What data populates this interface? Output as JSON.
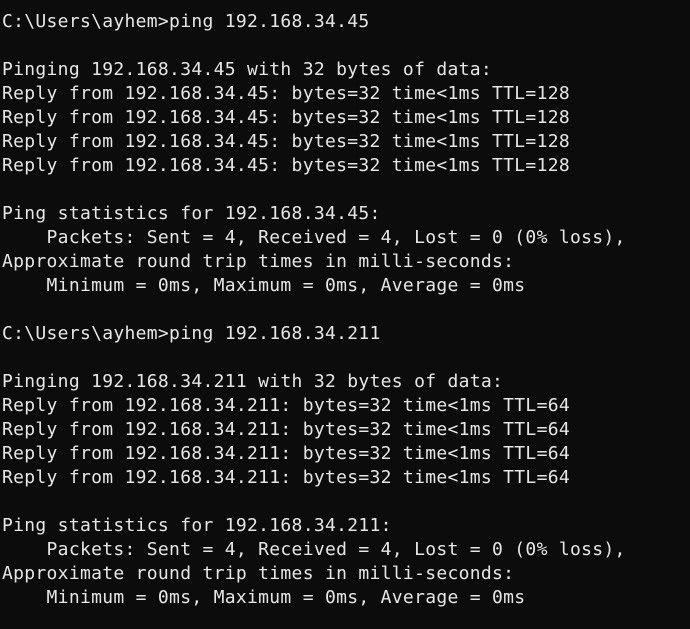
{
  "terminal": {
    "lines": [
      "C:\\Users\\ayhem>ping 192.168.34.45",
      "",
      "Pinging 192.168.34.45 with 32 bytes of data:",
      "Reply from 192.168.34.45: bytes=32 time<1ms TTL=128",
      "Reply from 192.168.34.45: bytes=32 time<1ms TTL=128",
      "Reply from 192.168.34.45: bytes=32 time<1ms TTL=128",
      "Reply from 192.168.34.45: bytes=32 time<1ms TTL=128",
      "",
      "Ping statistics for 192.168.34.45:",
      "    Packets: Sent = 4, Received = 4, Lost = 0 (0% loss),",
      "Approximate round trip times in milli-seconds:",
      "    Minimum = 0ms, Maximum = 0ms, Average = 0ms",
      "",
      "C:\\Users\\ayhem>ping 192.168.34.211",
      "",
      "Pinging 192.168.34.211 with 32 bytes of data:",
      "Reply from 192.168.34.211: bytes=32 time<1ms TTL=64",
      "Reply from 192.168.34.211: bytes=32 time<1ms TTL=64",
      "Reply from 192.168.34.211: bytes=32 time<1ms TTL=64",
      "Reply from 192.168.34.211: bytes=32 time<1ms TTL=64",
      "",
      "Ping statistics for 192.168.34.211:",
      "    Packets: Sent = 4, Received = 4, Lost = 0 (0% loss),",
      "Approximate round trip times in milli-seconds:",
      "    Minimum = 0ms, Maximum = 0ms, Average = 0ms"
    ],
    "colors": {
      "background": "#0c0c0c",
      "text": "#e6e6e6"
    }
  }
}
